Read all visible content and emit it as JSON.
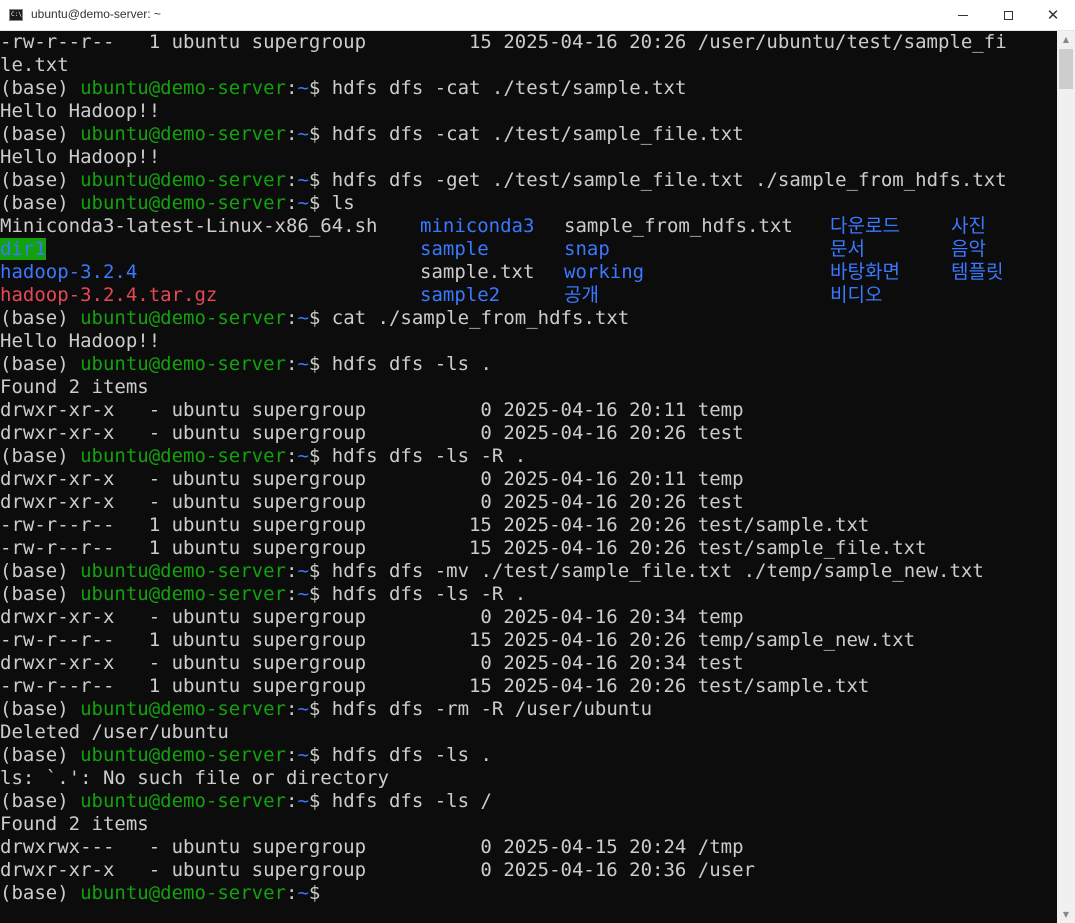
{
  "window": {
    "title": "ubuntu@demo-server: ~",
    "icon_label": "C:\\",
    "controls": {
      "minimize": "minimize-icon",
      "maximize": "maximize-icon",
      "close": "✕"
    }
  },
  "prompt": {
    "base": "(base) ",
    "user_host": "ubuntu@demo-server",
    "sep": ":",
    "path": "~",
    "dollar": "$ "
  },
  "colors": {
    "green": "#13a10e",
    "blue": "#3b78ff",
    "red": "#e74856",
    "text": "#cccccc",
    "background": "#0c0c0c"
  },
  "lines": [
    "-rw-r--r--   1 ubuntu supergroup         15 2025-04-16 20:26 /user/ubuntu/test/sample_fi",
    "le.txt",
    "hdfs dfs -cat ./test/sample.txt",
    "Hello Hadoop!!",
    "hdfs dfs -cat ./test/sample_file.txt",
    "Hello Hadoop!!",
    "hdfs dfs -get ./test/sample_file.txt ./sample_from_hdfs.txt",
    "ls",
    "cat ./sample_from_hdfs.txt",
    "Hello Hadoop!!",
    "hdfs dfs -ls .",
    "Found 2 items",
    "drwxr-xr-x   - ubuntu supergroup          0 2025-04-16 20:11 temp",
    "drwxr-xr-x   - ubuntu supergroup          0 2025-04-16 20:26 test",
    "hdfs dfs -ls -R .",
    "drwxr-xr-x   - ubuntu supergroup          0 2025-04-16 20:11 temp",
    "drwxr-xr-x   - ubuntu supergroup          0 2025-04-16 20:26 test",
    "-rw-r--r--   1 ubuntu supergroup         15 2025-04-16 20:26 test/sample.txt",
    "-rw-r--r--   1 ubuntu supergroup         15 2025-04-16 20:26 test/sample_file.txt",
    "hdfs dfs -mv ./test/sample_file.txt ./temp/sample_new.txt",
    "hdfs dfs -ls -R .",
    "drwxr-xr-x   - ubuntu supergroup          0 2025-04-16 20:34 temp",
    "-rw-r--r--   1 ubuntu supergroup         15 2025-04-16 20:26 temp/sample_new.txt",
    "drwxr-xr-x   - ubuntu supergroup          0 2025-04-16 20:34 test",
    "-rw-r--r--   1 ubuntu supergroup         15 2025-04-16 20:26 test/sample.txt",
    "hdfs dfs -rm -R /user/ubuntu",
    "Deleted /user/ubuntu",
    "hdfs dfs -ls .",
    "ls: `.': No such file or directory",
    "hdfs dfs -ls /",
    "Found 2 items",
    "drwxrwx---   - ubuntu supergroup          0 2025-04-15 20:24 /tmp",
    "drwxr-xr-x   - ubuntu supergroup          0 2025-04-16 20:36 /user"
  ],
  "ls_output": {
    "miniconda_sh": "Miniconda3-latest-Linux-x86_64.sh",
    "dir1": "dir1",
    "hadoop_dir": "hadoop-3.2.4",
    "hadoop_tgz": "hadoop-3.2.4.tar.gz",
    "miniconda3": "miniconda3",
    "sample": "sample",
    "sample_txt": "sample.txt",
    "sample2": "sample2",
    "sample_from_hdfs": "sample_from_hdfs.txt",
    "snap": "snap",
    "working": "working",
    "public": "공개",
    "downloads": "다운로드",
    "documents": "문서",
    "desktop": "바탕화면",
    "videos": "비디오",
    "pictures": "사진",
    "music": "음악",
    "templates": "템플릿"
  }
}
